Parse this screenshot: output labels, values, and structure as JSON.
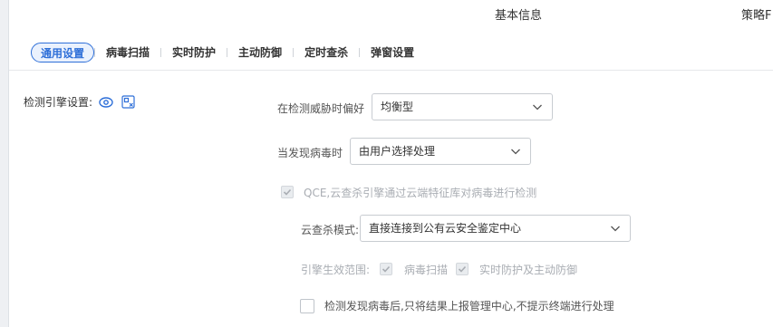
{
  "top_tabs": [
    "基本信息",
    "策略F"
  ],
  "subtabs": [
    {
      "label": "通用设置",
      "active": true
    },
    {
      "label": "病毒扫描",
      "active": false
    },
    {
      "label": "实时防护",
      "active": false
    },
    {
      "label": "主动防御",
      "active": false
    },
    {
      "label": "定时查杀",
      "active": false
    },
    {
      "label": "弹窗设置",
      "active": false
    }
  ],
  "section": {
    "label": "检测引擎设置:"
  },
  "threat_pref": {
    "label": "在检测威胁时偏好",
    "value": "均衡型"
  },
  "virus_found": {
    "label": "当发现病毒时",
    "value": "由用户选择处理"
  },
  "qce": {
    "label": "QCE,云查杀引擎通过云端特征库对病毒进行检测",
    "checked": true,
    "disabled": true
  },
  "cloud_mode": {
    "label": "云查杀模式:",
    "value": "直接连接到公有云安全鉴定中心"
  },
  "engine_scope": {
    "label": "引擎生效范围:",
    "options": [
      {
        "label": "病毒扫描",
        "checked": true
      },
      {
        "label": "实时防护及主动防御",
        "checked": true
      }
    ]
  },
  "report_only": {
    "label": "检测发现病毒后,只将结果上报管理中心,不提示终端进行处理",
    "checked": false
  },
  "colors": {
    "accent": "#2e6fd8",
    "disabled_text": "#a9adb3"
  }
}
